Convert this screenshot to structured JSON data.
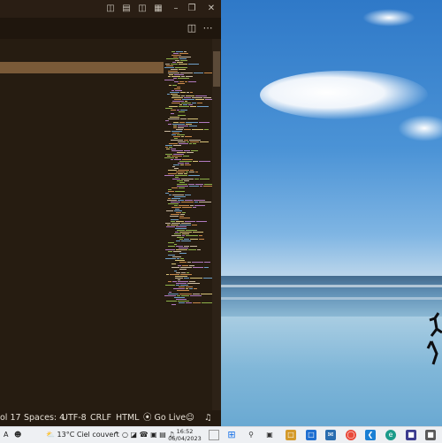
{
  "editor": {
    "titlebar_icons": [
      "layout-sidebar-icon",
      "layout-panel-icon",
      "layout-sidebar-right-icon",
      "customize-layout-icon",
      "minimize-icon",
      "restore-icon",
      "close-icon"
    ],
    "tab_actions": [
      "split-editor-icon",
      "more-actions-icon"
    ],
    "status": {
      "position": "ol 17",
      "spaces": "Spaces: 4",
      "encoding": "UTF-8",
      "eol": "CRLF",
      "language": "HTML",
      "go_live": "Go Live"
    },
    "colors": {
      "background": "#261c11",
      "highlight": "#7a5a38"
    }
  },
  "taskbar": {
    "weather": {
      "temp": "13°C",
      "condition": "Ciel couvert"
    },
    "clock": {
      "time": "16:52",
      "date": "06/04/2023"
    }
  }
}
